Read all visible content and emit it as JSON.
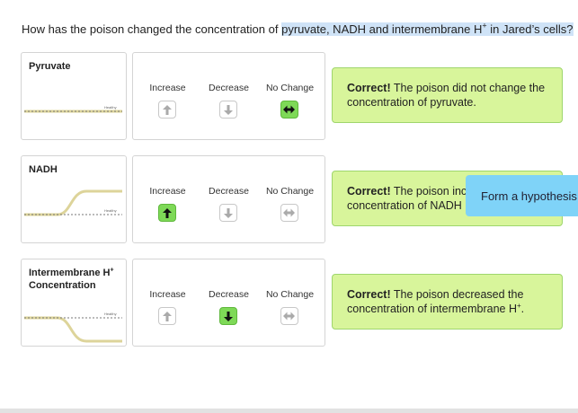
{
  "question": {
    "prefix": "How has the poison changed the concentration of ",
    "highlight_a": "pyruvate, NADH and intermembrane H",
    "highlight_sup": "+",
    "highlight_b": " in Jared’s cells?"
  },
  "healthy_label": "Healthy",
  "rows": [
    {
      "graph_title": "Pyruvate",
      "trend": "none",
      "choices": [
        "Increase",
        "Decrease",
        "No Change"
      ],
      "selected": "No Change",
      "feedback_bold": "Correct!",
      "feedback_text": " The poison did not change the concentration of pyruvate.",
      "feedback_sup": "",
      "feedback_end": ""
    },
    {
      "graph_title": "NADH",
      "trend": "increase",
      "choices": [
        "Increase",
        "Decrease",
        "No Change"
      ],
      "selected": "Increase",
      "feedback_bold": "Correct!",
      "feedback_text": " The poison inc",
      "feedback_line2": "concentration of NADH",
      "feedback_sup": "",
      "feedback_end": ""
    },
    {
      "graph_title_a": "Intermembrane H",
      "graph_title_sup": "+",
      "graph_title_b": "Concentration",
      "trend": "decrease",
      "choices": [
        "Increase",
        "Decrease",
        "No Change"
      ],
      "selected": "Decrease",
      "feedback_bold": "Correct!",
      "feedback_text": " The poison decreased the concentration of intermembrane H",
      "feedback_sup": "+",
      "feedback_end": "."
    }
  ],
  "tooltip": {
    "text": "Form a hypothesis."
  },
  "colors": {
    "feedback_bg": "#d8f59b",
    "selected_button": "#7ed957",
    "tooltip_bg": "#7fd3f8",
    "highlight": "#cfe3f7",
    "poison_curve": "#ddd49a"
  },
  "icons": {
    "increase": "arrow-up-icon",
    "decrease": "arrow-down-icon",
    "no_change": "arrow-left-right-icon"
  }
}
